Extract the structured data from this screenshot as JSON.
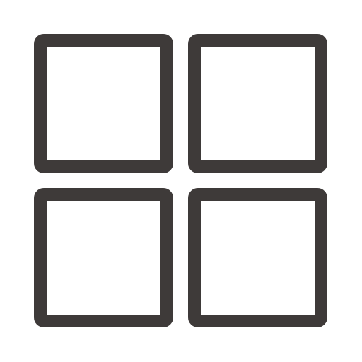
{
  "icon": {
    "name": "grid-view-icon",
    "stroke_color": "#3e3a39",
    "background_color": "#ffffff",
    "tiles": [
      {
        "name": "top-left-tile"
      },
      {
        "name": "top-right-tile"
      },
      {
        "name": "bottom-left-tile"
      },
      {
        "name": "bottom-right-tile"
      }
    ]
  }
}
